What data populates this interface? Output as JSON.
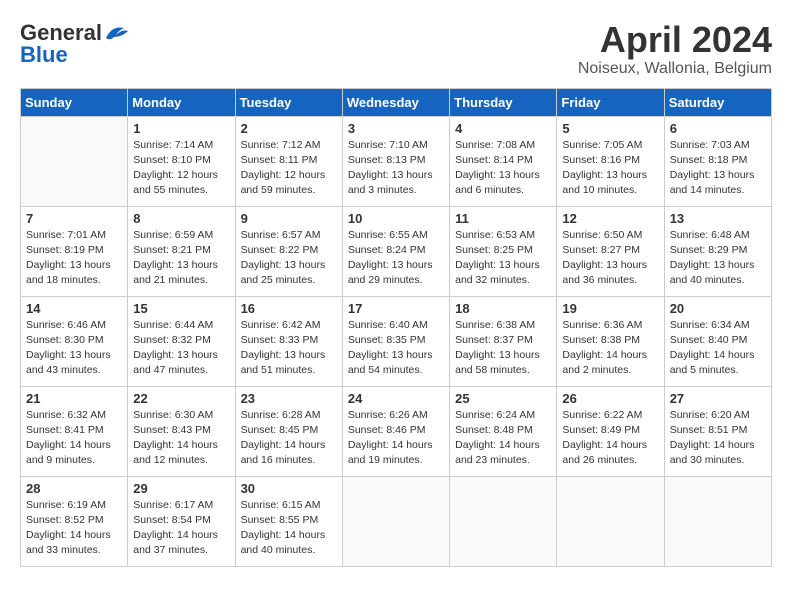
{
  "header": {
    "logo_line1": "General",
    "logo_line2": "Blue",
    "month": "April 2024",
    "location": "Noiseux, Wallonia, Belgium"
  },
  "days_of_week": [
    "Sunday",
    "Monday",
    "Tuesday",
    "Wednesday",
    "Thursday",
    "Friday",
    "Saturday"
  ],
  "weeks": [
    [
      {
        "day": "",
        "info": ""
      },
      {
        "day": "1",
        "info": "Sunrise: 7:14 AM\nSunset: 8:10 PM\nDaylight: 12 hours\nand 55 minutes."
      },
      {
        "day": "2",
        "info": "Sunrise: 7:12 AM\nSunset: 8:11 PM\nDaylight: 12 hours\nand 59 minutes."
      },
      {
        "day": "3",
        "info": "Sunrise: 7:10 AM\nSunset: 8:13 PM\nDaylight: 13 hours\nand 3 minutes."
      },
      {
        "day": "4",
        "info": "Sunrise: 7:08 AM\nSunset: 8:14 PM\nDaylight: 13 hours\nand 6 minutes."
      },
      {
        "day": "5",
        "info": "Sunrise: 7:05 AM\nSunset: 8:16 PM\nDaylight: 13 hours\nand 10 minutes."
      },
      {
        "day": "6",
        "info": "Sunrise: 7:03 AM\nSunset: 8:18 PM\nDaylight: 13 hours\nand 14 minutes."
      }
    ],
    [
      {
        "day": "7",
        "info": "Sunrise: 7:01 AM\nSunset: 8:19 PM\nDaylight: 13 hours\nand 18 minutes."
      },
      {
        "day": "8",
        "info": "Sunrise: 6:59 AM\nSunset: 8:21 PM\nDaylight: 13 hours\nand 21 minutes."
      },
      {
        "day": "9",
        "info": "Sunrise: 6:57 AM\nSunset: 8:22 PM\nDaylight: 13 hours\nand 25 minutes."
      },
      {
        "day": "10",
        "info": "Sunrise: 6:55 AM\nSunset: 8:24 PM\nDaylight: 13 hours\nand 29 minutes."
      },
      {
        "day": "11",
        "info": "Sunrise: 6:53 AM\nSunset: 8:25 PM\nDaylight: 13 hours\nand 32 minutes."
      },
      {
        "day": "12",
        "info": "Sunrise: 6:50 AM\nSunset: 8:27 PM\nDaylight: 13 hours\nand 36 minutes."
      },
      {
        "day": "13",
        "info": "Sunrise: 6:48 AM\nSunset: 8:29 PM\nDaylight: 13 hours\nand 40 minutes."
      }
    ],
    [
      {
        "day": "14",
        "info": "Sunrise: 6:46 AM\nSunset: 8:30 PM\nDaylight: 13 hours\nand 43 minutes."
      },
      {
        "day": "15",
        "info": "Sunrise: 6:44 AM\nSunset: 8:32 PM\nDaylight: 13 hours\nand 47 minutes."
      },
      {
        "day": "16",
        "info": "Sunrise: 6:42 AM\nSunset: 8:33 PM\nDaylight: 13 hours\nand 51 minutes."
      },
      {
        "day": "17",
        "info": "Sunrise: 6:40 AM\nSunset: 8:35 PM\nDaylight: 13 hours\nand 54 minutes."
      },
      {
        "day": "18",
        "info": "Sunrise: 6:38 AM\nSunset: 8:37 PM\nDaylight: 13 hours\nand 58 minutes."
      },
      {
        "day": "19",
        "info": "Sunrise: 6:36 AM\nSunset: 8:38 PM\nDaylight: 14 hours\nand 2 minutes."
      },
      {
        "day": "20",
        "info": "Sunrise: 6:34 AM\nSunset: 8:40 PM\nDaylight: 14 hours\nand 5 minutes."
      }
    ],
    [
      {
        "day": "21",
        "info": "Sunrise: 6:32 AM\nSunset: 8:41 PM\nDaylight: 14 hours\nand 9 minutes."
      },
      {
        "day": "22",
        "info": "Sunrise: 6:30 AM\nSunset: 8:43 PM\nDaylight: 14 hours\nand 12 minutes."
      },
      {
        "day": "23",
        "info": "Sunrise: 6:28 AM\nSunset: 8:45 PM\nDaylight: 14 hours\nand 16 minutes."
      },
      {
        "day": "24",
        "info": "Sunrise: 6:26 AM\nSunset: 8:46 PM\nDaylight: 14 hours\nand 19 minutes."
      },
      {
        "day": "25",
        "info": "Sunrise: 6:24 AM\nSunset: 8:48 PM\nDaylight: 14 hours\nand 23 minutes."
      },
      {
        "day": "26",
        "info": "Sunrise: 6:22 AM\nSunset: 8:49 PM\nDaylight: 14 hours\nand 26 minutes."
      },
      {
        "day": "27",
        "info": "Sunrise: 6:20 AM\nSunset: 8:51 PM\nDaylight: 14 hours\nand 30 minutes."
      }
    ],
    [
      {
        "day": "28",
        "info": "Sunrise: 6:19 AM\nSunset: 8:52 PM\nDaylight: 14 hours\nand 33 minutes."
      },
      {
        "day": "29",
        "info": "Sunrise: 6:17 AM\nSunset: 8:54 PM\nDaylight: 14 hours\nand 37 minutes."
      },
      {
        "day": "30",
        "info": "Sunrise: 6:15 AM\nSunset: 8:55 PM\nDaylight: 14 hours\nand 40 minutes."
      },
      {
        "day": "",
        "info": ""
      },
      {
        "day": "",
        "info": ""
      },
      {
        "day": "",
        "info": ""
      },
      {
        "day": "",
        "info": ""
      }
    ]
  ]
}
